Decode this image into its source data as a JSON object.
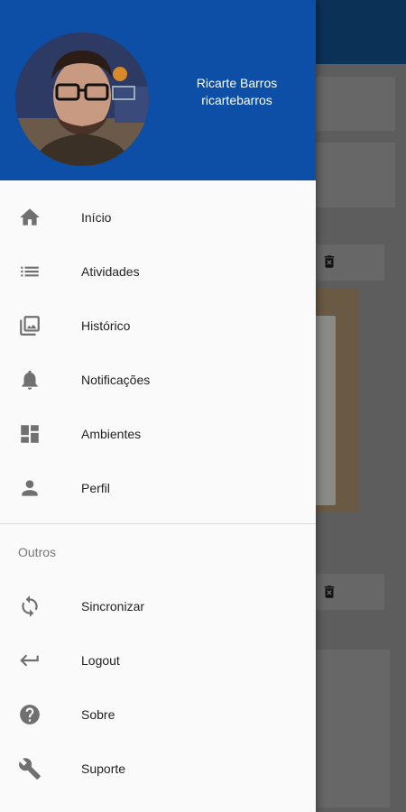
{
  "user": {
    "name": "Ricarte Barros",
    "username": "ricartebarros"
  },
  "menu": {
    "primary": [
      {
        "label": "Início",
        "icon": "home-icon"
      },
      {
        "label": "Atividades",
        "icon": "list-icon"
      },
      {
        "label": "Histórico",
        "icon": "photo-library-icon"
      },
      {
        "label": "Notificações",
        "icon": "bell-icon"
      },
      {
        "label": "Ambientes",
        "icon": "dashboard-icon"
      },
      {
        "label": "Perfil",
        "icon": "person-icon"
      }
    ],
    "section_title": "Outros",
    "secondary": [
      {
        "label": "Sincronizar",
        "icon": "sync-icon"
      },
      {
        "label": "Logout",
        "icon": "logout-arrow-icon"
      },
      {
        "label": "Sobre",
        "icon": "help-icon"
      },
      {
        "label": "Suporte",
        "icon": "wrench-icon"
      }
    ]
  },
  "colors": {
    "header": "#0d4ea6",
    "appbar": "#0c3156",
    "drawer_bg": "#fafafa",
    "icon": "#707070"
  }
}
